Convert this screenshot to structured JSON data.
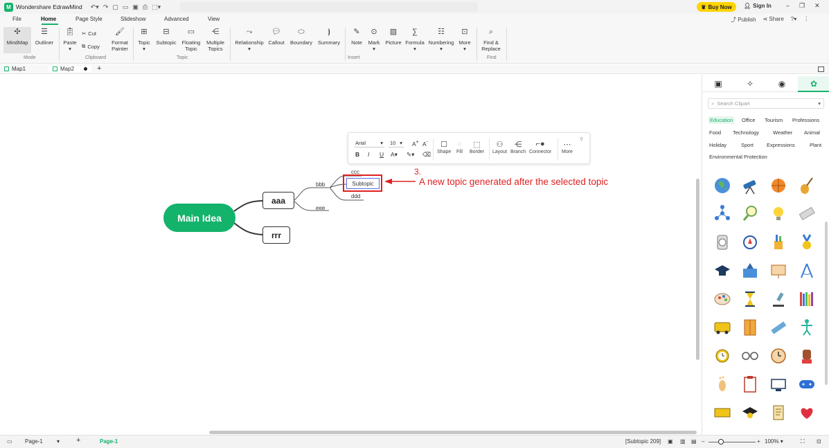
{
  "app": {
    "title": "Wondershare EdrawMind"
  },
  "titlebar": {
    "buy_now": "Buy Now",
    "sign_in": "Sign In",
    "publish": "Publish",
    "share": "Share"
  },
  "menu": [
    "File",
    "Home",
    "Page Style",
    "Slideshow",
    "Advanced",
    "View"
  ],
  "ribbon": {
    "mindmap": "MindMap",
    "outliner": "Outliner",
    "mode": "Mode",
    "paste": "Paste",
    "cut": "Cut",
    "copy": "Copy",
    "format": "Format",
    "painter": "Painter",
    "clipboard": "Clipboard",
    "topic": "Topic",
    "subtopic": "Subtopic",
    "floating": "Floating",
    "floating_topic": "Topic",
    "multiple": "Multiple",
    "multiple_topics": "Topics",
    "topic_group": "Topic",
    "relationship": "Relationship",
    "callout": "Callout",
    "boundary": "Boundary",
    "summary": "Summary",
    "note": "Note",
    "mark": "Mark",
    "picture": "Picture",
    "formula": "Formula",
    "numbering": "Numbering",
    "more": "More",
    "insert": "Insert",
    "find_amp": "Find &",
    "replace": "Replace",
    "find": "Find"
  },
  "tabs": [
    "Map1",
    "Map2"
  ],
  "mindmap": {
    "main": "Main Idea",
    "aaa": "aaa",
    "rrr": "rrr",
    "bbb": "bbb",
    "eee": "eee",
    "ccc": "ccc",
    "subtopic": "Subtopic",
    "ddd": "ddd"
  },
  "annotation": {
    "number": "3.",
    "text": "A new topic generated after the selected topic",
    "color": "#e02020"
  },
  "floatbar": {
    "font": "Arial",
    "size": "10",
    "shape": "Shape",
    "fill": "Fill",
    "border": "Border",
    "layout": "Layout",
    "branch": "Branch",
    "connector": "Connector",
    "more": "More"
  },
  "panel": {
    "search_placeholder": "Search Clipart",
    "categories": [
      "Education",
      "Office",
      "Tourism",
      "Professions",
      "Food",
      "Technology",
      "Weather",
      "Animal",
      "Holiday",
      "Sport",
      "Expressions",
      "Plant",
      "Environmental Protection"
    ]
  },
  "status": {
    "page": "Page-1",
    "page_tab": "Page-1",
    "selection": "[Subtopic 209]",
    "zoom": "100%"
  },
  "colors": {
    "brand": "#13b36b",
    "highlight": "#e02020",
    "buy": "#ffd400"
  }
}
